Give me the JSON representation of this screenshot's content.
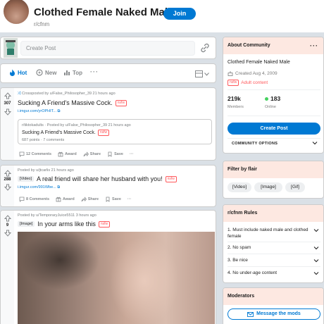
{
  "header": {
    "title": "Clothed Female Naked Male",
    "join_label": "Join",
    "subreddit": "r/cfnm"
  },
  "create_post": {
    "placeholder": "Create Post"
  },
  "sort": {
    "items": [
      "Hot",
      "New",
      "Top"
    ],
    "more": "···"
  },
  "posts": [
    {
      "votes": "307",
      "meta": "Crossposted by u/False_Philosopher_39 21 hours ago",
      "title": "Sucking A Friend's Massive Cock.",
      "nsfw": "nsfw",
      "link": "i.imgur.com/yrOPHIT...",
      "crosspost": {
        "meta": "r/tiktokadults · Posted by u/False_Philosopher_39 21 hours ago",
        "title": "Sucking A Friend's Massive Cock.",
        "nsfw": "nsfw",
        "stats": "687 points · 7 comments"
      },
      "actions": [
        "12 Comments",
        "Award",
        "Share",
        "Save",
        "···"
      ]
    },
    {
      "votes": "288",
      "meta": "Posted by u/jtcarlis 21 hours ago",
      "flair": "[Video]",
      "title": "A real friend will share her husband with you!",
      "nsfw": "nsfw",
      "link": "i.imgur.com/991Wbe...",
      "actions": [
        "8 Comments",
        "Award",
        "Share",
        "Save",
        "···"
      ]
    },
    {
      "votes": "9",
      "meta": "Posted by u/TemporaryJuice5511 3 hours ago",
      "flair": "[Image]",
      "title": "In your arms like this",
      "nsfw": "nsfw"
    }
  ],
  "sidebar": {
    "about": {
      "heading": "About Community",
      "dots": "···",
      "description": "Clothed Female Naked Male",
      "created": "Created Aug 4, 2009",
      "nsfw_badge": "nsfw",
      "adult_label": "Adult content",
      "members_count": "219k",
      "members_label": "Members",
      "online_count": "183",
      "online_label": "Online",
      "create_post_label": "Create Post",
      "community_options_label": "COMMUNITY OPTIONS"
    },
    "flair": {
      "heading": "Filter by flair",
      "items": [
        "[Video]",
        "[Image]",
        "[Gif]"
      ]
    },
    "rules": {
      "heading": "r/cfnm Rules",
      "items": [
        "1. Must include naked male and clothed female",
        "2. No spam",
        "3. Be nice",
        "4. No under-age content"
      ]
    },
    "moderators": {
      "heading": "Moderators",
      "message_label": "Message the mods"
    }
  },
  "colors": {
    "brand_blue": "#0079d3",
    "nsfw_red": "#ff585b",
    "widget_header": "#fde8e1",
    "page_bg": "#dae0e6"
  }
}
